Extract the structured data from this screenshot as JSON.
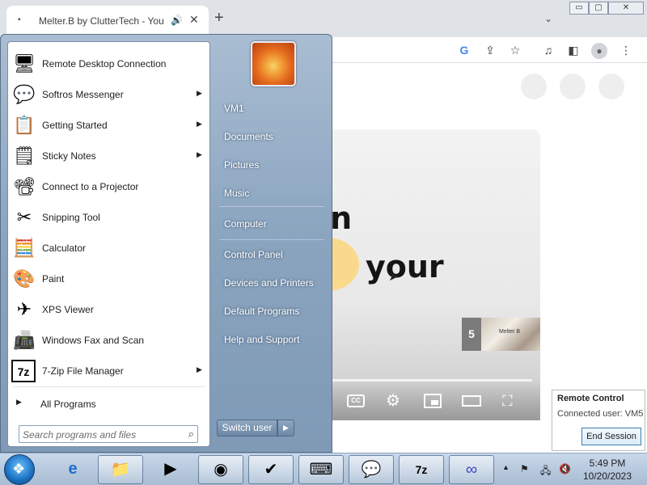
{
  "browser": {
    "tab_title": "Melter.B by ClutterTech - You",
    "new_tab": "+",
    "tab_search": "⌄",
    "window_buttons": [
      "▭",
      "▢",
      "✕"
    ]
  },
  "video": {
    "line1": "can",
    "line2": "your",
    "endcard_number": "5",
    "endcard_thumb_text": "Melter B",
    "cc_label": "CC"
  },
  "start_menu": {
    "programs": [
      {
        "label": "Remote Desktop Connection",
        "icon": "remote-desktop-icon",
        "glyph": "🖥",
        "arrow": false
      },
      {
        "label": "Softros Messenger",
        "icon": "messenger-icon",
        "glyph": "💬",
        "arrow": true
      },
      {
        "label": "Getting Started",
        "icon": "getting-started-icon",
        "glyph": "📋",
        "arrow": true
      },
      {
        "label": "Sticky Notes",
        "icon": "sticky-notes-icon",
        "glyph": "🗒",
        "arrow": true
      },
      {
        "label": "Connect to a Projector",
        "icon": "projector-icon",
        "glyph": "📽",
        "arrow": false
      },
      {
        "label": "Snipping Tool",
        "icon": "snipping-tool-icon",
        "glyph": "✂",
        "arrow": false
      },
      {
        "label": "Calculator",
        "icon": "calculator-icon",
        "glyph": "🧮",
        "arrow": false
      },
      {
        "label": "Paint",
        "icon": "paint-icon",
        "glyph": "🎨",
        "arrow": false
      },
      {
        "label": "XPS Viewer",
        "icon": "xps-viewer-icon",
        "glyph": "✈",
        "arrow": false
      },
      {
        "label": "Windows Fax and Scan",
        "icon": "fax-scan-icon",
        "glyph": "📠",
        "arrow": false
      },
      {
        "label": "7-Zip File Manager",
        "icon": "seven-zip-icon",
        "glyph": "7z",
        "arrow": true
      }
    ],
    "all_programs": "All Programs",
    "search_placeholder": "Search programs and files",
    "right_links": [
      "VM1",
      "Documents",
      "Pictures",
      "Music",
      "Computer",
      "Control Panel",
      "Devices and Printers",
      "Default Programs",
      "Help and Support"
    ],
    "switch_user": "Switch user"
  },
  "remote_control": {
    "title": "Remote Control",
    "connected": "Connected user: VM5",
    "end_session": "End Session"
  },
  "taskbar": {
    "time": "5:49 PM",
    "date": "10/20/2023"
  }
}
